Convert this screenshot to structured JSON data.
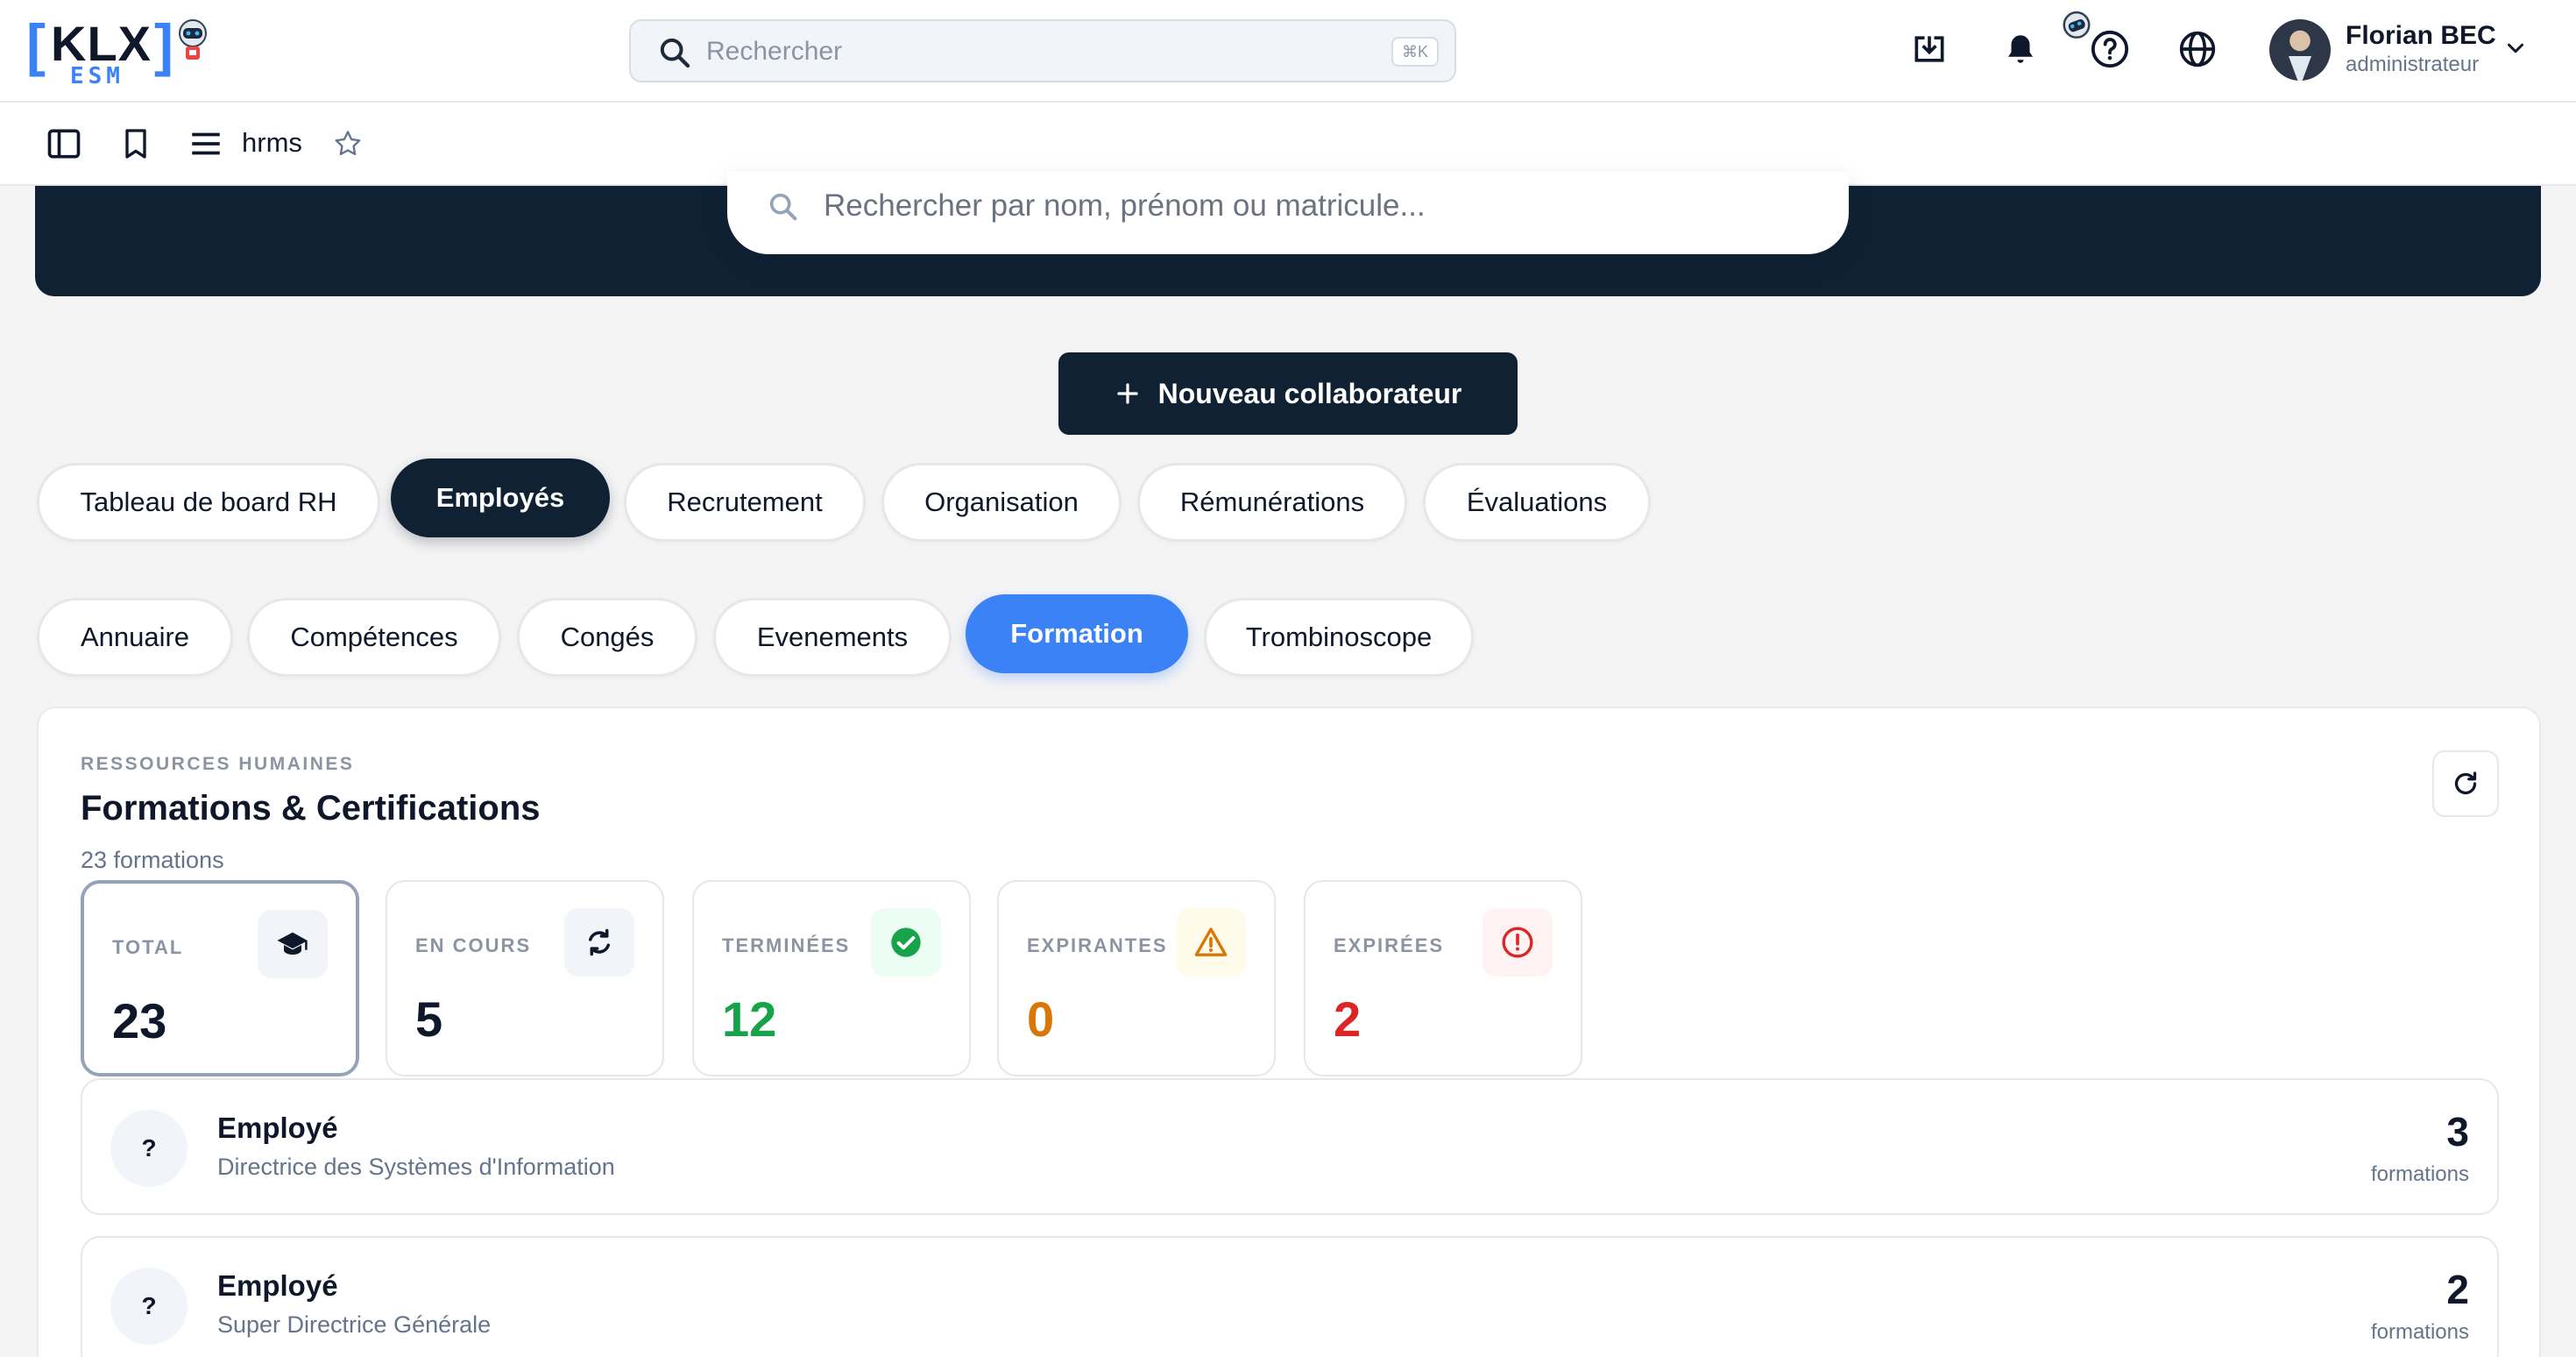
{
  "header": {
    "logo": {
      "bracket_left": "[",
      "bracket_right": "]",
      "name": "KLX",
      "sub": "ESM"
    },
    "search": {
      "placeholder": "Rechercher",
      "shortcut": "⌘K"
    },
    "icons": [
      "download-icon",
      "bell-icon",
      "robot-icon",
      "help-icon",
      "globe-icon"
    ],
    "user": {
      "name": "Florian BEC",
      "role": "administrateur"
    }
  },
  "subbar": {
    "module": "hrms",
    "icons": [
      "sidebar-toggle-icon",
      "bookmark-icon",
      "menu-icon",
      "star-icon"
    ]
  },
  "hero": {
    "search_placeholder": "Rechercher par nom, prénom ou matricule..."
  },
  "actions": {
    "new_collaborator": "Nouveau collaborateur"
  },
  "main_tabs": [
    {
      "label": "Tableau de board RH",
      "active": false
    },
    {
      "label": "Employés",
      "active": true
    },
    {
      "label": "Recrutement",
      "active": false
    },
    {
      "label": "Organisation",
      "active": false
    },
    {
      "label": "Rémunérations",
      "active": false
    },
    {
      "label": "Évaluations",
      "active": false
    }
  ],
  "sub_tabs": [
    {
      "label": "Annuaire",
      "active": false
    },
    {
      "label": "Compétences",
      "active": false
    },
    {
      "label": "Congés",
      "active": false
    },
    {
      "label": "Evenements",
      "active": false
    },
    {
      "label": "Formation",
      "active": true
    },
    {
      "label": "Trombinoscope",
      "active": false
    }
  ],
  "card": {
    "eyebrow": "RESSOURCES HUMAINES",
    "title": "Formations & Certifications",
    "subtitle": "23 formations",
    "stats": [
      {
        "label": "TOTAL",
        "value": "23",
        "color": "#0f172a",
        "icon": "graduation-cap-icon",
        "icon_bg": "#f1f5f9"
      },
      {
        "label": "EN COURS",
        "value": "5",
        "color": "#0f172a",
        "icon": "refresh-cycle-icon",
        "icon_bg": "#f1f5f9"
      },
      {
        "label": "TERMINÉES",
        "value": "12",
        "color": "#16a34a",
        "icon": "check-circle-icon",
        "icon_bg": "#ecfdf3"
      },
      {
        "label": "EXPIRANTES",
        "value": "0",
        "color": "#d97706",
        "icon": "warning-icon",
        "icon_bg": "#fffbeb"
      },
      {
        "label": "EXPIRÉES",
        "value": "2",
        "color": "#dc2626",
        "icon": "alert-circle-icon",
        "icon_bg": "#fef2f2"
      }
    ],
    "rows": [
      {
        "initial": "?",
        "name": "Employé",
        "position": "Directrice des Systèmes d'Information",
        "count": "3",
        "count_label": "formations"
      },
      {
        "initial": "?",
        "name": "Employé",
        "position": "Super Directrice Générale",
        "count": "2",
        "count_label": "formations"
      }
    ]
  },
  "colors": {
    "navy": "#0f2133",
    "accent_blue": "#3b82f6",
    "page_bg": "#f4f4f5"
  }
}
